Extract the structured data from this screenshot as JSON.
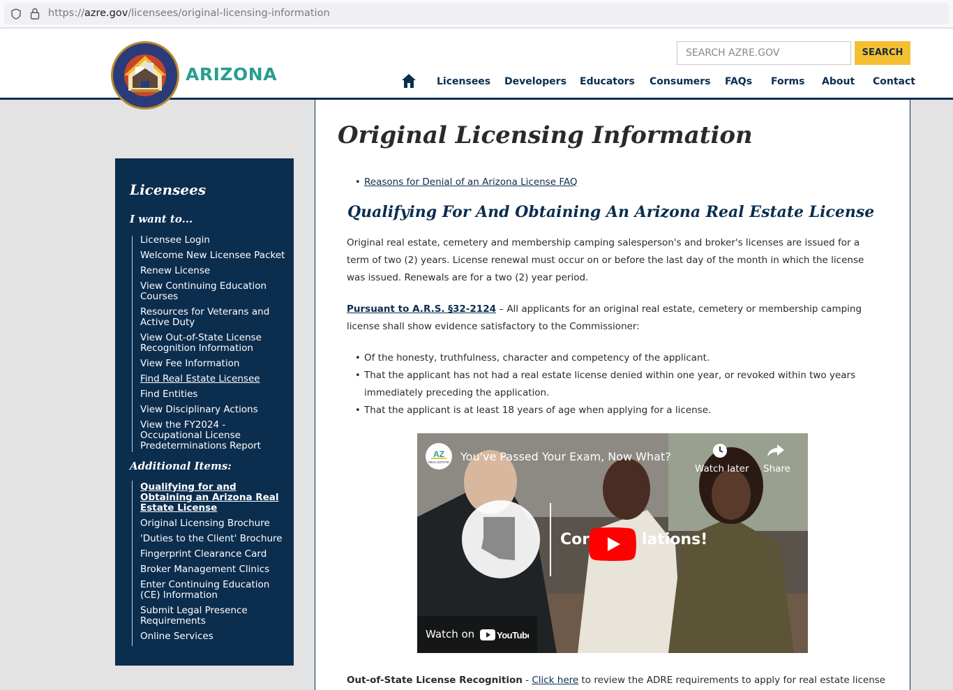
{
  "browser": {
    "url_prefix": "https://",
    "url_host": "azre.gov",
    "url_path": "/licensees/original-licensing-information"
  },
  "header": {
    "logo_text": "ARIZONA",
    "seal_label": "ARIZONA DEPARTMENT OF REAL ESTATE",
    "search_placeholder": "SEARCH AZRE.GOV",
    "search_button": "SEARCH",
    "nav": [
      "Licensees",
      "Developers",
      "Educators",
      "Consumers",
      "FAQs",
      "Forms",
      "About",
      "Contact"
    ]
  },
  "sidebar": {
    "title": "Licensees",
    "subtitle": "I want to...",
    "links": [
      "Licensee Login",
      "Welcome New Licensee Packet",
      "Renew License",
      "View Continuing Education Courses",
      "Resources for Veterans and Active Duty",
      "View Out-of-State License Recognition Information",
      "View Fee Information",
      "Find Real Estate Licensee",
      "Find Entities",
      "View Disciplinary Actions",
      "View the FY2024 - Occupational License Predeterminations Report"
    ],
    "additional_title": "Additional Items:",
    "additional_links": [
      "Qualifying for and Obtaining an Arizona Real Estate License",
      "Original Licensing Brochure",
      "'Duties to the Client' Brochure",
      "Fingerprint Clearance Card",
      "Broker Management Clinics",
      "Enter Continuing Education (CE) Information",
      "Submit Legal Presence Requirements",
      "Online Services"
    ]
  },
  "main": {
    "title": "Original Licensing Information",
    "faq_link": "Reasons for Denial of an Arizona License FAQ",
    "section_title": "Qualifying For And Obtaining An Arizona Real Estate License",
    "intro": "Original real estate, cemetery and membership camping salesperson's and broker's licenses are issued for a term of two (2) years. License renewal must occur on or before the last day of the month in which the license was issued. Renewals are for a two (2) year period.",
    "statute_link": "Pursuant to A.R.S. §32-2124",
    "statute_text": " – All applicants for an original real estate, cemetery or membership camping license shall show evidence satisfactory to the Commissioner:",
    "requirements": [
      "Of the honesty, truthfulness, character and competency of the applicant.",
      "That the applicant has not had a real estate license denied within one year, or revoked within two years immediately preceding the application.",
      "That the applicant is at least 18 years of age when applying for a license."
    ],
    "video": {
      "title": "You've Passed Your Exam, Now What?",
      "watch_later": "Watch later",
      "share": "Share",
      "overlay_left": "Con",
      "overlay_right": "lations!",
      "watch_on": "Watch on",
      "youtube": "YouTube",
      "logo_text": "AZ",
      "logo_sub": "REAL ESTATE"
    },
    "oos_label": "Out-of-State License Recognition",
    "oos_sep": " - ",
    "oos_link": "Click here",
    "oos_text": " to review the ADRE requirements to apply for real estate license"
  },
  "colors": {
    "navy": "#0b2d4e",
    "gold": "#f4c033",
    "teal": "#2a9d8f"
  }
}
